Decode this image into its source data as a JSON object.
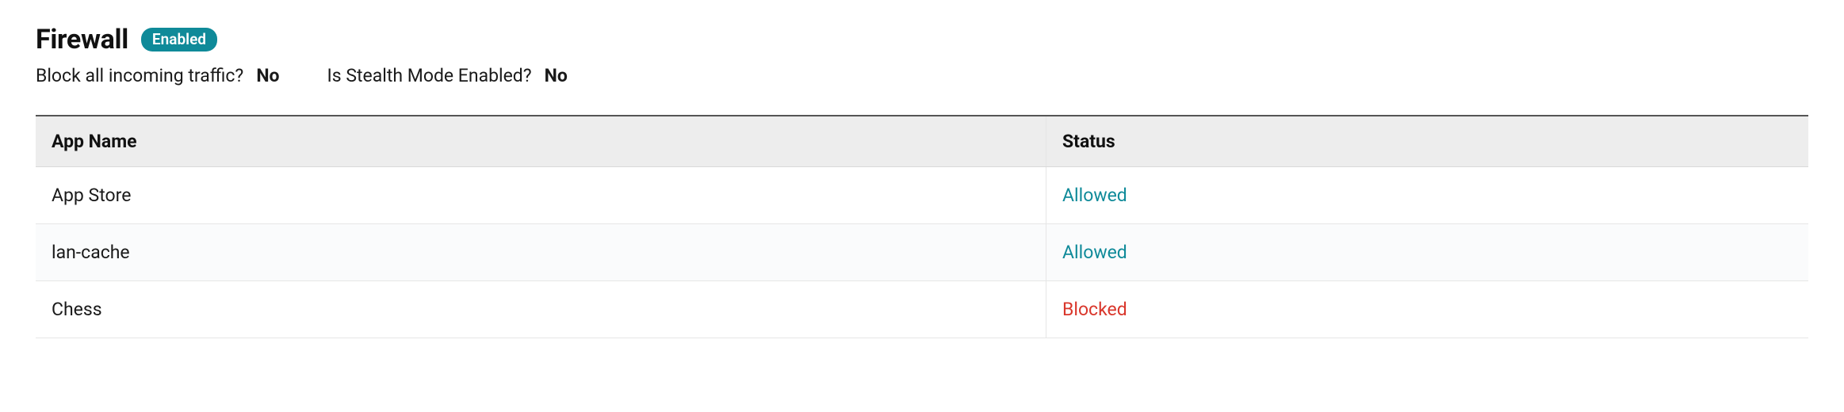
{
  "header": {
    "title": "Firewall",
    "badge": "Enabled"
  },
  "meta": {
    "block_incoming": {
      "label": "Block all incoming traffic?",
      "value": "No"
    },
    "stealth_mode": {
      "label": "Is Stealth Mode Enabled?",
      "value": "No"
    }
  },
  "table": {
    "columns": {
      "app_name": "App Name",
      "status": "Status"
    },
    "rows": [
      {
        "app_name": "App Store",
        "status": "Allowed",
        "status_class": "status-allowed"
      },
      {
        "app_name": "lan-cache",
        "status": "Allowed",
        "status_class": "status-allowed"
      },
      {
        "app_name": "Chess",
        "status": "Blocked",
        "status_class": "status-blocked"
      }
    ]
  },
  "colors": {
    "badge_bg": "#0f8a99",
    "allowed": "#0f8a99",
    "blocked": "#d9362b"
  }
}
